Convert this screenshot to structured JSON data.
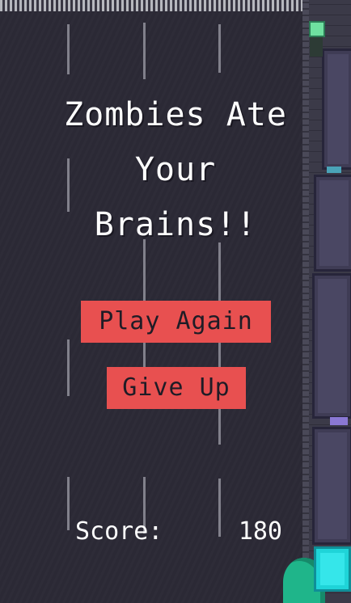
{
  "game_over": {
    "title_lines": [
      "Zombies Ate",
      "Your",
      "Brains!!"
    ]
  },
  "buttons": {
    "play_again": "Play Again",
    "give_up": "Give Up"
  },
  "score": {
    "label": "Score:",
    "value": "180"
  },
  "colors": {
    "button_background": "#e85050",
    "button_text": "#1f1c26",
    "road": "#2c2a36",
    "text": "#ffffff"
  }
}
